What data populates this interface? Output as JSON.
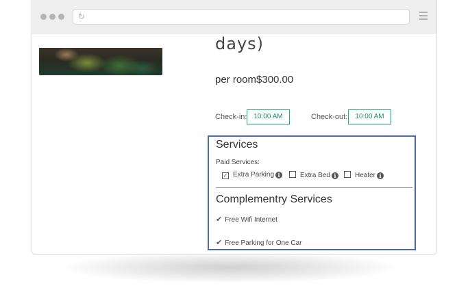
{
  "browser": {
    "menu_icon": "hamburger-icon",
    "reload_icon": "reload-icon"
  },
  "room": {
    "title_fragment": "days)",
    "price_text": "per room$300.00",
    "check_in_label": "Check-in:",
    "check_in_time": "10:00 AM",
    "check_out_label": "Check-out:",
    "check_out_time": "10:00 AM",
    "accent_color": "#1fa37a"
  },
  "services": {
    "title": "Services",
    "paid_label": "Paid Services:",
    "paid_options": [
      {
        "label": "Extra Parking",
        "checked": true
      },
      {
        "label": "Extra Bed",
        "checked": false
      },
      {
        "label": "Heater",
        "checked": false
      }
    ],
    "complementary_title": "Complementry Services",
    "complementary_items": [
      "Free Wifi Internet",
      "Free Parking for One Car"
    ],
    "highlight_color": "#4a6aa8"
  }
}
